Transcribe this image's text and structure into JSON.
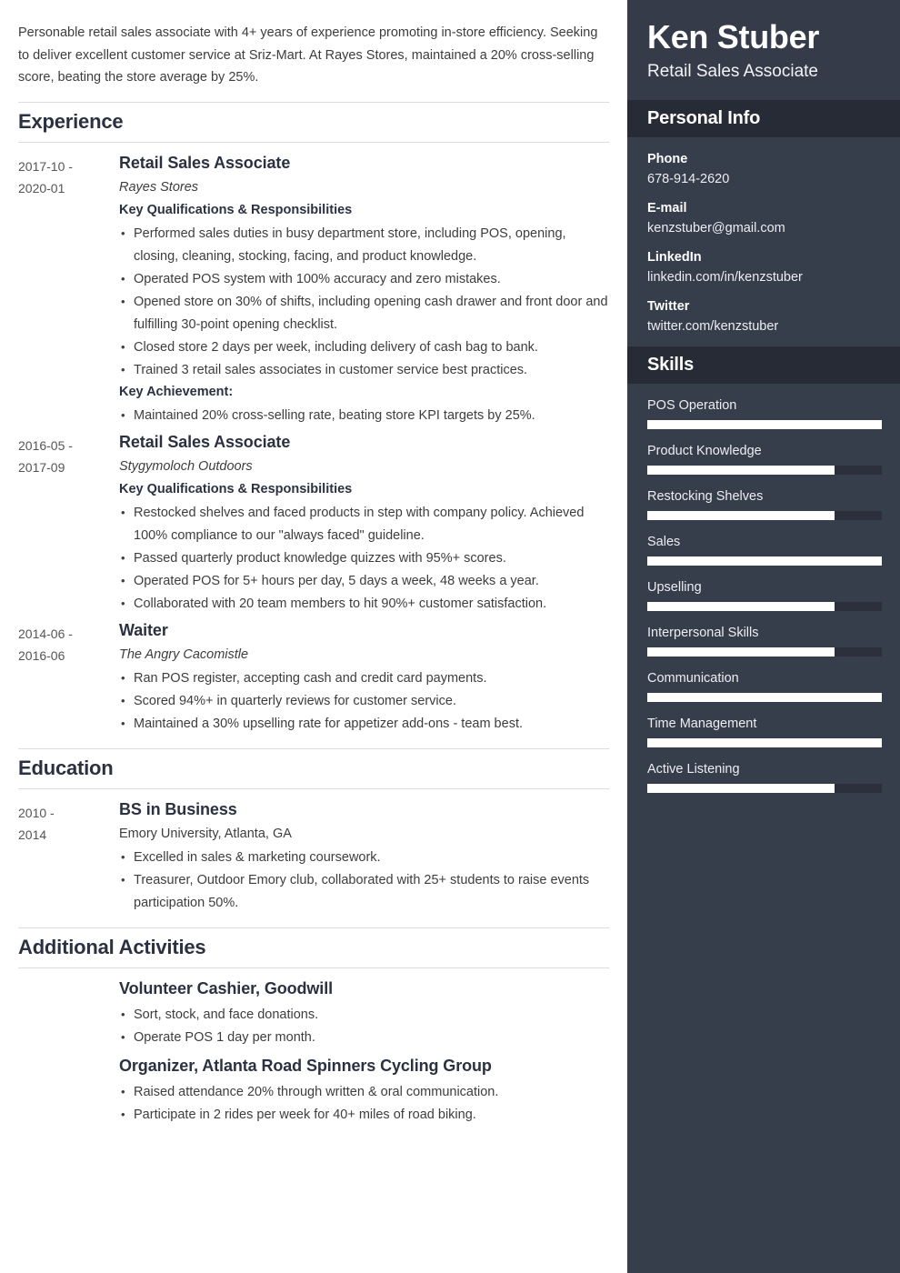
{
  "summary": "Personable retail sales associate with 4+ years of experience promoting in-store efficiency. Seeking to deliver excellent customer service at Sriz-Mart. At Rayes Stores, maintained a 20% cross-selling score, beating the store average by 25%.",
  "sections": {
    "experience_title": "Experience",
    "education_title": "Education",
    "activities_title": "Additional Activities"
  },
  "experience": [
    {
      "date_start": "2017-10 -",
      "date_end": "2020-01",
      "title": "Retail Sales Associate",
      "org": "Rayes Stores",
      "subhead": "Key Qualifications & Responsibilities",
      "bullets": [
        "Performed sales duties in busy department store, including POS, opening, closing, cleaning, stocking, facing, and product knowledge.",
        "Operated POS system with 100% accuracy and zero mistakes.",
        "Opened store on 30% of shifts, including opening cash drawer and front door and fulfilling 30-point opening checklist.",
        "Closed store 2 days per week, including delivery of cash bag to bank.",
        "Trained 3 retail sales associates in customer service best practices."
      ],
      "achievement_label": "Key Achievement:",
      "achievement_bullets": [
        "Maintained 20% cross-selling rate, beating store KPI targets by 25%."
      ]
    },
    {
      "date_start": "2016-05 -",
      "date_end": "2017-09",
      "title": "Retail Sales Associate",
      "org": "Stygymoloch Outdoors",
      "subhead": "Key Qualifications & Responsibilities",
      "bullets": [
        "Restocked shelves and faced products in step with company policy. Achieved 100% compliance to our \"always faced\" guideline.",
        "Passed quarterly product knowledge quizzes with 95%+ scores.",
        "Operated POS for 5+ hours per day, 5 days a week, 48 weeks a year.",
        "Collaborated with 20 team members to hit 90%+ customer satisfaction."
      ]
    },
    {
      "date_start": "2014-06 -",
      "date_end": "2016-06",
      "title": "Waiter",
      "org": "The Angry Cacomistle",
      "bullets": [
        "Ran POS register, accepting cash and credit card payments.",
        "Scored 94%+ in quarterly reviews for customer service.",
        "Maintained a 30% upselling rate for appetizer add-ons - team best."
      ]
    }
  ],
  "education": [
    {
      "date_start": "2010 -",
      "date_end": "2014",
      "title": "BS in Business",
      "org": "Emory University, Atlanta, GA",
      "bullets": [
        "Excelled in sales & marketing coursework.",
        "Treasurer, Outdoor Emory club, collaborated with 25+ students to raise events participation 50%."
      ]
    }
  ],
  "activities": [
    {
      "title": "Volunteer Cashier, Goodwill",
      "bullets": [
        "Sort, stock, and face donations.",
        "Operate POS 1 day per month."
      ]
    },
    {
      "title": "Organizer, Atlanta Road Spinners Cycling Group",
      "bullets": [
        "Raised attendance 20% through written & oral communication.",
        "Participate in 2 rides per week for 40+ miles of road biking."
      ]
    }
  ],
  "sidebar": {
    "name": "Ken Stuber",
    "role": "Retail Sales Associate",
    "personal_info_title": "Personal Info",
    "skills_title": "Skills",
    "contacts": [
      {
        "label": "Phone",
        "value": "678-914-2620"
      },
      {
        "label": "E-mail",
        "value": "kenzstuber@gmail.com"
      },
      {
        "label": "LinkedIn",
        "value": "linkedin.com/in/kenzstuber"
      },
      {
        "label": "Twitter",
        "value": "twitter.com/kenzstuber"
      }
    ],
    "skills": [
      {
        "label": "POS Operation",
        "level": 100
      },
      {
        "label": "Product Knowledge",
        "level": 80
      },
      {
        "label": "Restocking Shelves",
        "level": 80
      },
      {
        "label": "Sales",
        "level": 100
      },
      {
        "label": "Upselling",
        "level": 80
      },
      {
        "label": "Interpersonal Skills",
        "level": 80
      },
      {
        "label": "Communication",
        "level": 100
      },
      {
        "label": "Time Management",
        "level": 100
      },
      {
        "label": "Active Listening",
        "level": 80
      }
    ]
  },
  "colors": {
    "sidebar_bg": "#363d4b",
    "sidebar_header_bg": "#353b48",
    "sidebar_band_bg": "#262b35",
    "heading": "#2b3140",
    "skill_fill": "#ffffff",
    "skill_track": "#2b303c"
  }
}
